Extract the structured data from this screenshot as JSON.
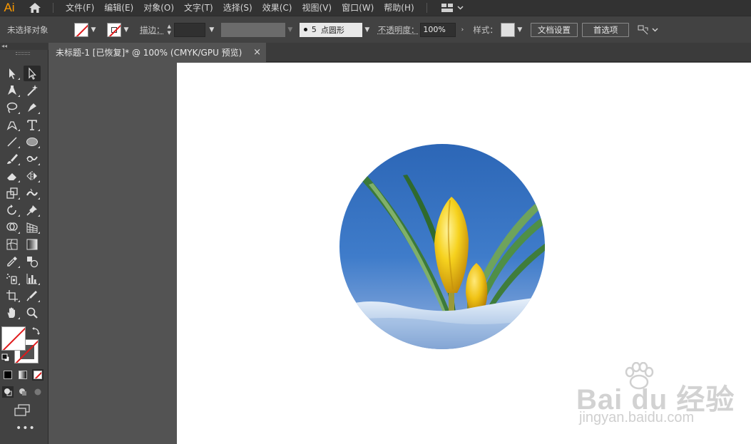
{
  "app": {
    "logo": "Ai"
  },
  "menu": [
    "文件(F)",
    "编辑(E)",
    "对象(O)",
    "文字(T)",
    "选择(S)",
    "效果(C)",
    "视图(V)",
    "窗口(W)",
    "帮助(H)"
  ],
  "control": {
    "selection_status": "未选择对象",
    "stroke_label": "描边：",
    "brush_number": "5",
    "brush_name": "点圆形",
    "opacity_label": "不透明度：",
    "opacity_value": "100%",
    "style_label": "样式：",
    "doc_setup": "文档设置",
    "preferences": "首选项"
  },
  "document": {
    "tab_title": "未标题-1 [已恢复]* @ 100% (CMYK/GPU 预览)",
    "close_glyph": "×"
  },
  "colors": {
    "menubar": "#323232",
    "controlbar": "#424242",
    "toolbar": "#424242",
    "pasteboard": "#535353",
    "artboard": "#ffffff",
    "none_slash": "#e0191b",
    "logo": "#ff9a00"
  },
  "artwork": {
    "description_icon": "crocus-photo-circle"
  },
  "watermark": {
    "main": "Bai du 经验",
    "sub": "jingyan.baidu.com"
  }
}
